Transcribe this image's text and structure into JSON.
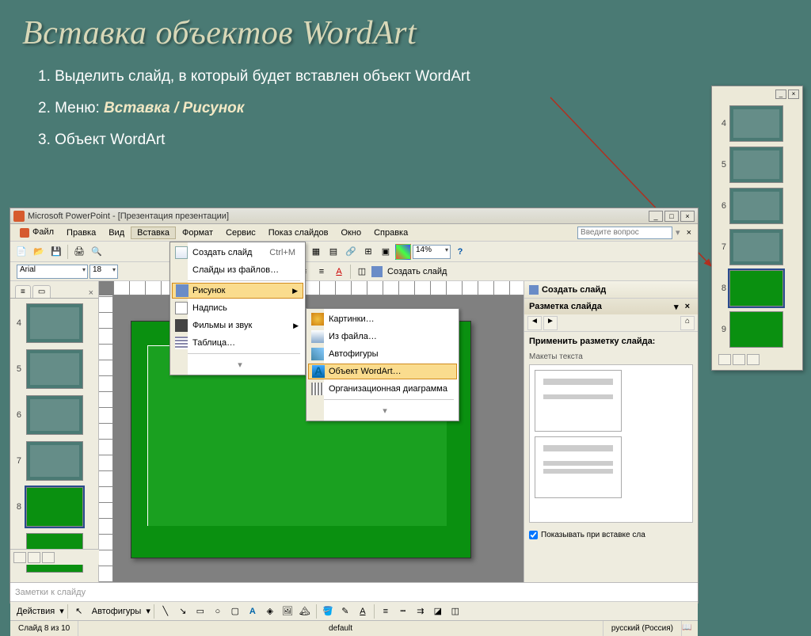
{
  "title": "Вставка объектов WordArt",
  "steps": {
    "s1": "1. Выделить слайд, в который будет вставлен объект WordArt",
    "s2_prefix": "2. Меню: ",
    "s2_hl": "Вставка / Рисунок",
    "s3": "3. Объект WordArt"
  },
  "app": {
    "title": "Microsoft PowerPoint - [Презентация презентации]",
    "menu": [
      "Файл",
      "Правка",
      "Вид",
      "Вставка",
      "Формат",
      "Сервис",
      "Показ слайдов",
      "Окно",
      "Справка"
    ],
    "help_placeholder": "Введите вопрос",
    "zoom": "14%",
    "font": "Arial",
    "size": "18",
    "new_slide": "Создать слайд",
    "notes": "Заметки к слайду",
    "draw_actions": "Действия",
    "autoshapes": "Автофигуры",
    "status_slide": "Слайд 8 из 10",
    "status_design": "default",
    "status_lang": "русский (Россия)"
  },
  "insert_menu": {
    "i1": "Создать слайд",
    "i1_sc": "Ctrl+M",
    "i2": "Слайды из файлов…",
    "i3": "Рисунок",
    "i4": "Надпись",
    "i5": "Фильмы и звук",
    "i6": "Таблица…"
  },
  "pic_menu": {
    "p1": "Картинки…",
    "p2": "Из файла…",
    "p3": "Автофигуры",
    "p4": "Объект WordArt…",
    "p5": "Организационная диаграмма"
  },
  "task": {
    "new_slide": "Создать слайд",
    "title": "Разметка слайда",
    "apply": "Применить разметку слайда:",
    "sub": "Макеты текста",
    "show": "Показывать при вставке сла"
  },
  "thumbs": [
    "4",
    "5",
    "6",
    "7",
    "8",
    "9"
  ],
  "side_thumbs": [
    "4",
    "5",
    "6",
    "7",
    "8",
    "9"
  ]
}
